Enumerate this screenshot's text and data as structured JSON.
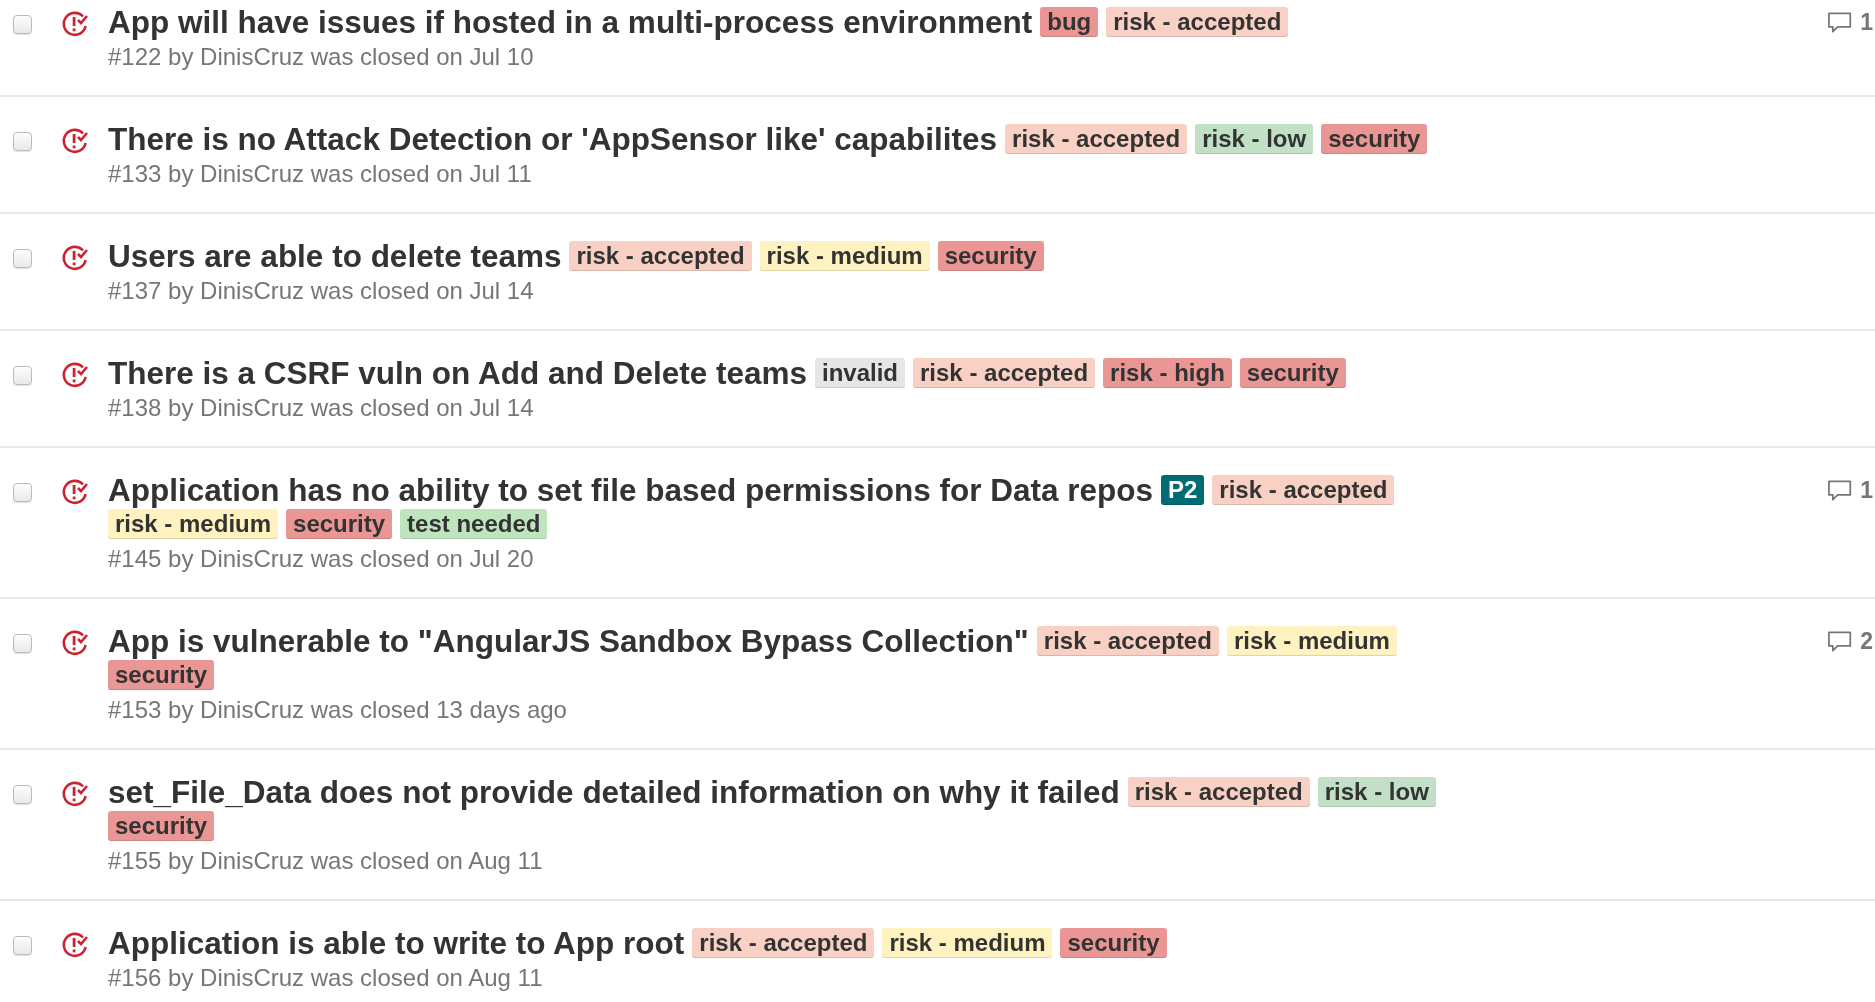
{
  "issues": [
    {
      "selected": false,
      "title": "App will have issues if hosted in a multi-process environment",
      "labels": [
        {
          "name": "bug",
          "color": "#e99695"
        },
        {
          "name": "risk - accepted",
          "color": "#f9d0c4"
        }
      ],
      "meta": "#122 by DinisCruz was closed on Jul 10",
      "comments": "1"
    },
    {
      "selected": false,
      "title": "There is no Attack Detection or 'AppSensor like' capabilites",
      "labels": [
        {
          "name": "risk - accepted",
          "color": "#f9d0c4"
        },
        {
          "name": "risk - low",
          "color": "#c2e0c6"
        },
        {
          "name": "security",
          "color": "#e99695"
        }
      ],
      "meta": "#133 by DinisCruz was closed on Jul 11"
    },
    {
      "selected": false,
      "title": "Users are able to delete teams",
      "labels": [
        {
          "name": "risk - accepted",
          "color": "#f9d0c4"
        },
        {
          "name": "risk - medium",
          "color": "#fef2c0"
        },
        {
          "name": "security",
          "color": "#e99695"
        }
      ],
      "meta": "#137 by DinisCruz was closed on Jul 14"
    },
    {
      "selected": false,
      "title": "There is a CSRF vuln on Add and Delete teams",
      "labels": [
        {
          "name": "invalid",
          "color": "#e6e6e6"
        },
        {
          "name": "risk - accepted",
          "color": "#f9d0c4"
        },
        {
          "name": "risk - high",
          "color": "#e99695"
        },
        {
          "name": "security",
          "color": "#e99695"
        }
      ],
      "meta": "#138 by DinisCruz was closed on Jul 14"
    },
    {
      "selected": false,
      "title": "Application has no ability to set file based permissions for Data repos",
      "labels": [
        {
          "name": "P2",
          "color": "#006b75"
        },
        {
          "name": "risk - accepted",
          "color": "#f9d0c4"
        },
        {
          "name": "risk - medium",
          "color": "#fef2c0"
        },
        {
          "name": "security",
          "color": "#e99695"
        },
        {
          "name": "test needed",
          "color": "#bfe5bf"
        }
      ],
      "meta": "#145 by DinisCruz was closed on Jul 20",
      "comments": "1"
    },
    {
      "selected": false,
      "title": "App is vulnerable to \"AngularJS Sandbox Bypass Collection\"",
      "labels": [
        {
          "name": "risk - accepted",
          "color": "#f9d0c4"
        },
        {
          "name": "risk - medium",
          "color": "#fef2c0"
        },
        {
          "name": "security",
          "color": "#e99695"
        }
      ],
      "meta": "#153 by DinisCruz was closed 13 days ago",
      "comments": "2"
    },
    {
      "selected": false,
      "title": "set_File_Data does not provide detailed information on why it failed",
      "labels": [
        {
          "name": "risk - accepted",
          "color": "#f9d0c4"
        },
        {
          "name": "risk - low",
          "color": "#c2e0c6"
        },
        {
          "name": "security",
          "color": "#e99695"
        }
      ],
      "meta": "#155 by DinisCruz was closed on Aug 11"
    },
    {
      "selected": false,
      "title": "Application is able to write to App root",
      "labels": [
        {
          "name": "risk - accepted",
          "color": "#f9d0c4"
        },
        {
          "name": "risk - medium",
          "color": "#fef2c0"
        },
        {
          "name": "security",
          "color": "#e99695"
        }
      ],
      "meta": "#156 by DinisCruz was closed on Aug 11"
    }
  ]
}
